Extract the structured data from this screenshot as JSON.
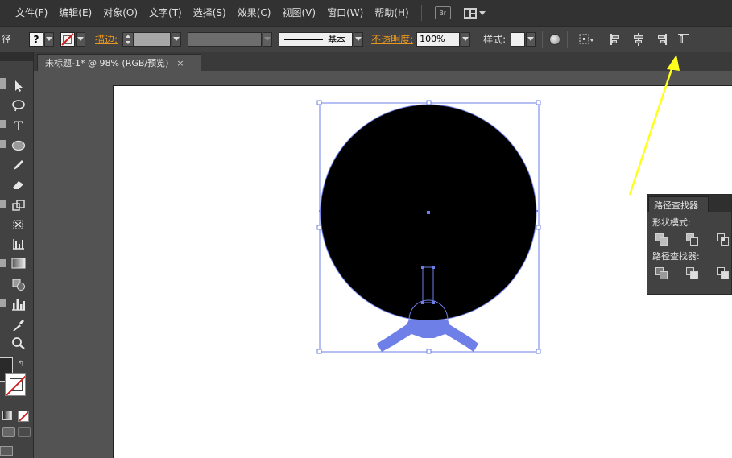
{
  "menubar": {
    "items": [
      "文件(F)",
      "编辑(E)",
      "对象(O)",
      "文字(T)",
      "选择(S)",
      "效果(C)",
      "视图(V)",
      "窗口(W)",
      "帮助(H)"
    ],
    "bridge_label": "Br"
  },
  "controlbar": {
    "selection_label": "径",
    "stroke_label": "描边:",
    "line_style": "基本",
    "opacity_label": "不透明度:",
    "opacity_value": "100%",
    "style_label": "样式:"
  },
  "document": {
    "tab_title": "未标题-1* @ 98% (RGB/预览)",
    "close_glyph": "×"
  },
  "pathfinder": {
    "title": "路径查找器",
    "shape_modes_label": "形状模式:",
    "pathfinders_label": "路径查找器:"
  },
  "colors": {
    "selection_blue": "#6e7fe8",
    "arrow_yellow": "#ffff1e",
    "accent_orange": "#e8961e"
  },
  "icons": [
    "selection-tool-icon",
    "lasso-tool-icon",
    "type-tool-icon",
    "ellipse-tool-icon",
    "pencil-tool-icon",
    "eraser-tool-icon",
    "scale-tool-icon",
    "free-transform-icon",
    "graph-tool-icon",
    "gradient-tool-icon",
    "shape-builder-icon",
    "column-graph-icon",
    "eyedropper-icon",
    "zoom-icon"
  ]
}
